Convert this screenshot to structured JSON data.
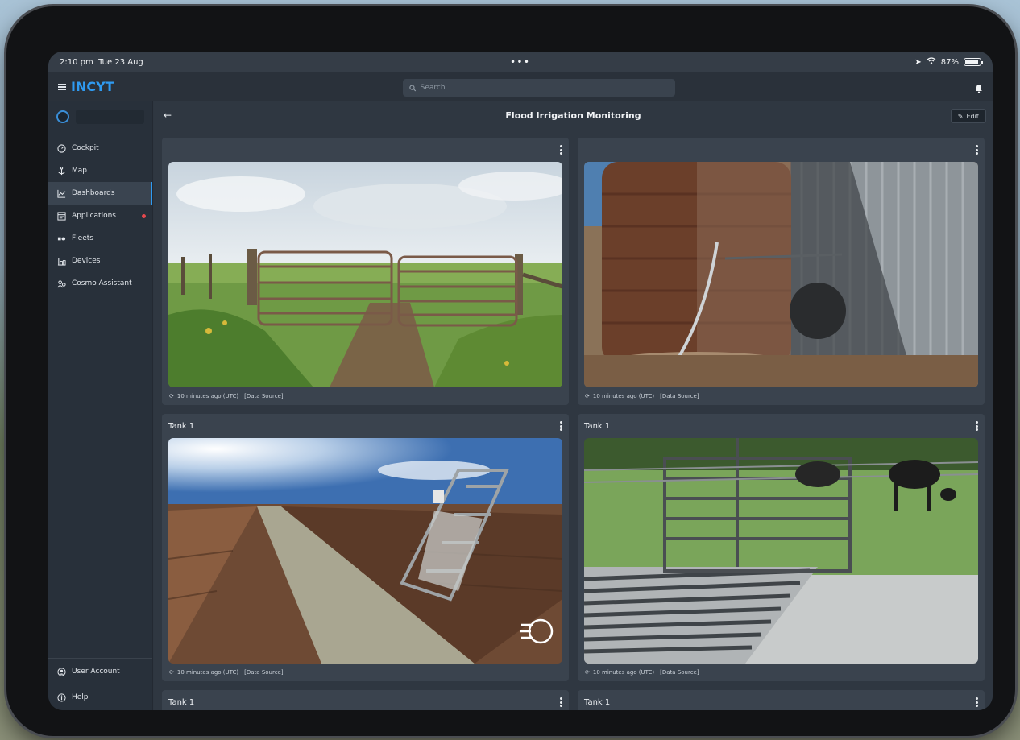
{
  "status_bar": {
    "time": "2:10 pm",
    "date": "Tue 23 Aug",
    "battery": "87%",
    "battery_level": 0.87
  },
  "app": {
    "brand": "INCYT"
  },
  "search": {
    "placeholder": "Search"
  },
  "sidebar": {
    "items": [
      {
        "label": "Cockpit",
        "icon": "gauge-icon"
      },
      {
        "label": "Map",
        "icon": "anchor-icon"
      },
      {
        "label": "Dashboards",
        "icon": "chart-line-icon",
        "active": true
      },
      {
        "label": "Applications",
        "icon": "app-window-icon",
        "badge": true
      },
      {
        "label": "Fleets",
        "icon": "fleet-icon"
      },
      {
        "label": "Devices",
        "icon": "devices-icon"
      },
      {
        "label": "Cosmo Assistant",
        "icon": "assistant-icon"
      }
    ],
    "bottom": [
      {
        "label": "User Account",
        "icon": "user-icon"
      },
      {
        "label": "Help",
        "icon": "info-icon"
      }
    ]
  },
  "page": {
    "title": "Flood Irrigation Monitoring",
    "edit_label": "Edit"
  },
  "cards": [
    {
      "title": "",
      "footer_time": "10 minutes ago (UTC)",
      "footer_source": "[Data Source]",
      "scene": "farm-gate"
    },
    {
      "title": "",
      "footer_time": "10 minutes ago (UTC)",
      "footer_source": "[Data Source]",
      "scene": "water-tank"
    },
    {
      "title": "Tank 1",
      "footer_time": "10 minutes ago (UTC)",
      "footer_source": "[Data Source]",
      "scene": "irrigation-channel"
    },
    {
      "title": "Tank 1",
      "footer_time": "10 minutes ago (UTC)",
      "footer_source": "[Data Source]",
      "scene": "cattle-grid"
    },
    {
      "title": "Tank 1"
    },
    {
      "title": "Tank 1"
    }
  ],
  "colors": {
    "accent": "#2f9bf2",
    "background": "#2e3640",
    "card": "#3a434e",
    "badge": "#e5484d"
  }
}
